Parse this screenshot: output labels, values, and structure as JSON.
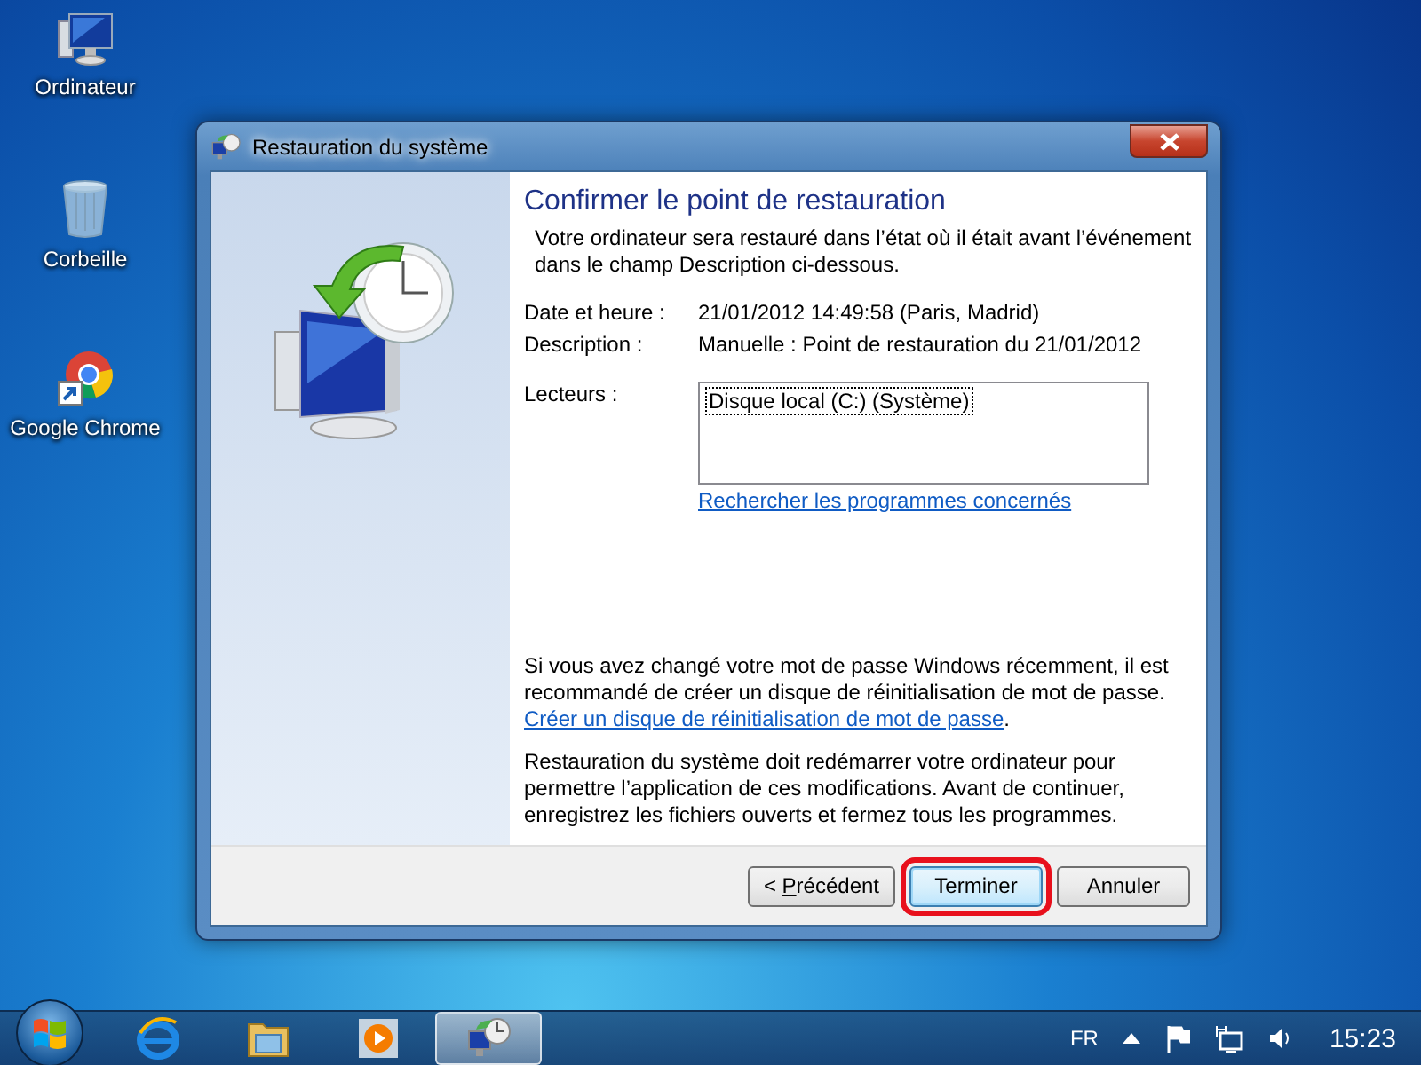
{
  "desktop_icons": [
    {
      "kind": "computer",
      "label": "Ordinateur"
    },
    {
      "kind": "bin",
      "label": "Corbeille"
    },
    {
      "kind": "browser",
      "label": "Google Chrome"
    }
  ],
  "window": {
    "title": "Restauration du système",
    "heading": "Confirmer le point de restauration",
    "intro": "Votre ordinateur sera restauré dans l’état où il était avant l’événement dans le champ Description ci-dessous.",
    "fields": [
      {
        "label": "Date et heure :",
        "value": "21/01/2012 14:49:58 (Paris, Madrid)"
      },
      {
        "label": "Description :",
        "value": "Manuelle : Point de restauration du 21/01/2012"
      }
    ],
    "drives": {
      "label": "Lecteurs :",
      "items": [
        {
          "text": "Disque local (C:) (Système)",
          "focused": true
        }
      ],
      "link": "Rechercher les programmes concernés"
    },
    "password_note": {
      "text": "Si vous avez changé votre mot de passe Windows récemment, il est recommandé de créer un disque de réinitialisation de mot de passe. ",
      "link": "Créer un disque de réinitialisation de mot de passe",
      "end": "."
    },
    "restart_note": "Restauration du système doit redémarrer votre ordinateur pour permettre l’application de ces modifications. Avant de continuer, enregistrez les fichiers ouverts et fermez tous les programmes.",
    "buttons": [
      {
        "before": "< ",
        "mnemonic": "P",
        "after": "récédent",
        "default": false,
        "annotated": false
      },
      {
        "before": "Terminer",
        "default": true,
        "annotated": true
      },
      {
        "before": "Annuler",
        "default": false,
        "annotated": false
      }
    ]
  },
  "taskbar": {
    "items": [
      {
        "kind": "ie",
        "active": false
      },
      {
        "kind": "folder",
        "active": false
      },
      {
        "kind": "media",
        "active": false
      },
      {
        "kind": "restore",
        "active": true
      }
    ],
    "language": "FR",
    "clock": "15:23"
  }
}
